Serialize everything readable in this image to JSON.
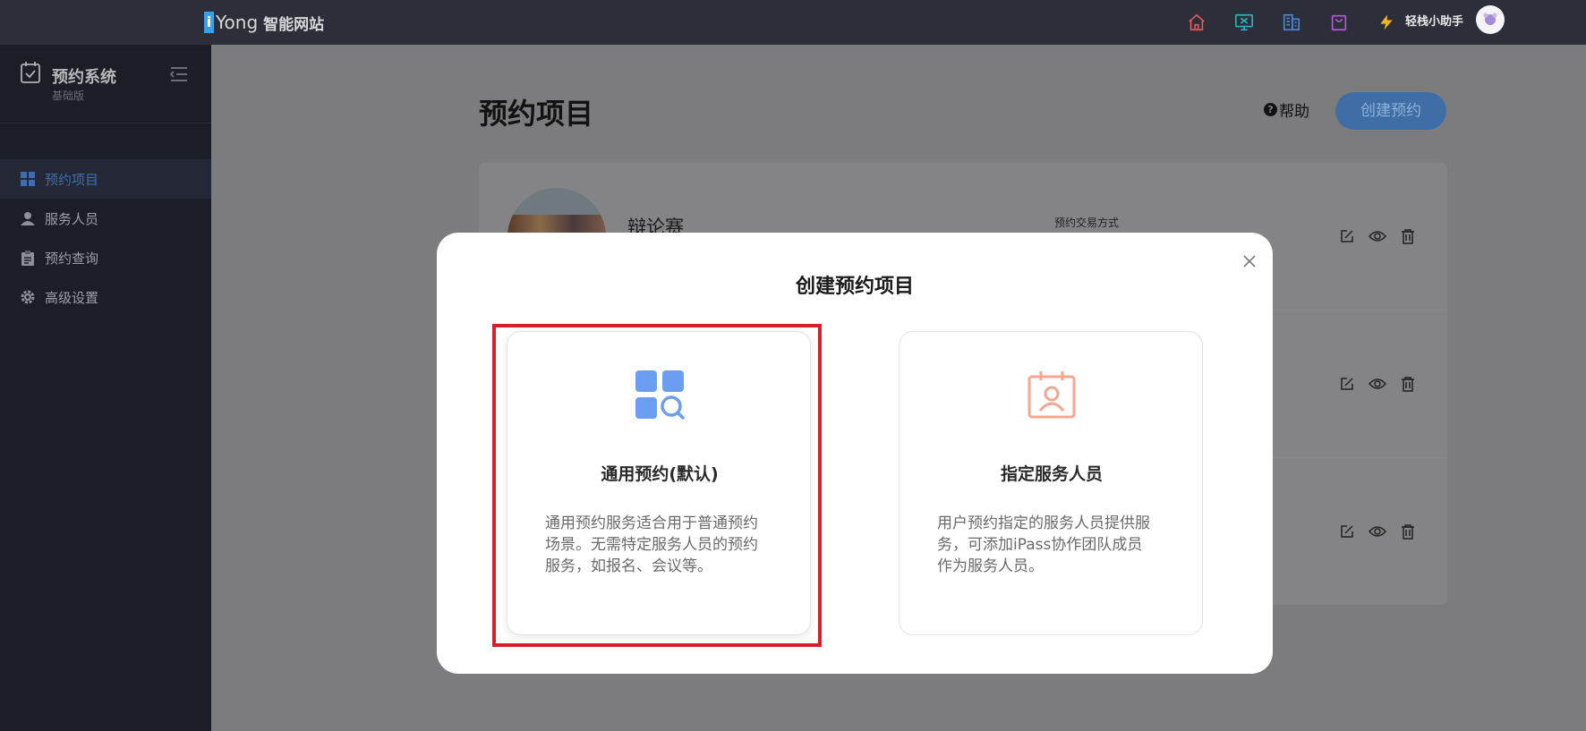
{
  "topbar": {
    "brand_i": "i",
    "brand_name": "Yong",
    "brand_site": "智能网站",
    "icons": [
      "home-icon",
      "monitor-icon",
      "building-icon",
      "bag-icon",
      "lightning-icon"
    ],
    "user_name": "轻栈小助手"
  },
  "sidebar": {
    "title": "预约系统",
    "subtitle": "基础版",
    "items": [
      {
        "label": "预约项目",
        "icon": "grid-icon",
        "active": true
      },
      {
        "label": "服务人员",
        "icon": "person-icon",
        "active": false
      },
      {
        "label": "预约查询",
        "icon": "clipboard-icon",
        "active": false
      },
      {
        "label": "高级设置",
        "icon": "gear-icon",
        "active": false
      }
    ]
  },
  "main": {
    "page_title": "预约项目",
    "help_label": "帮助",
    "create_button": "创建预约",
    "rows": [
      {
        "name": "辩论赛",
        "meta_label": "预约交易方式"
      },
      {
        "name": "",
        "meta_label": ""
      },
      {
        "name": "",
        "meta_label": ""
      }
    ]
  },
  "modal": {
    "title": "创建预约项目",
    "options": [
      {
        "title": "通用预约(默认)",
        "desc_lines": [
          "通用预约服务适合用于普通预约",
          "场景。无需特定服务人员的预约",
          "服务，如报名、会议等。"
        ],
        "icon": "grid-search-icon",
        "icon_color": "#6b9df0"
      },
      {
        "title": "指定服务人员",
        "desc_lines": [
          "用户预约指定的服务人员提供服",
          "务，可添加iPass协作团队成员",
          "作为服务人员。"
        ],
        "icon": "calendar-person-icon",
        "icon_color": "#f3a692"
      }
    ]
  },
  "colors": {
    "highlight": "#d5202b",
    "accent": "#3d6fb0"
  }
}
